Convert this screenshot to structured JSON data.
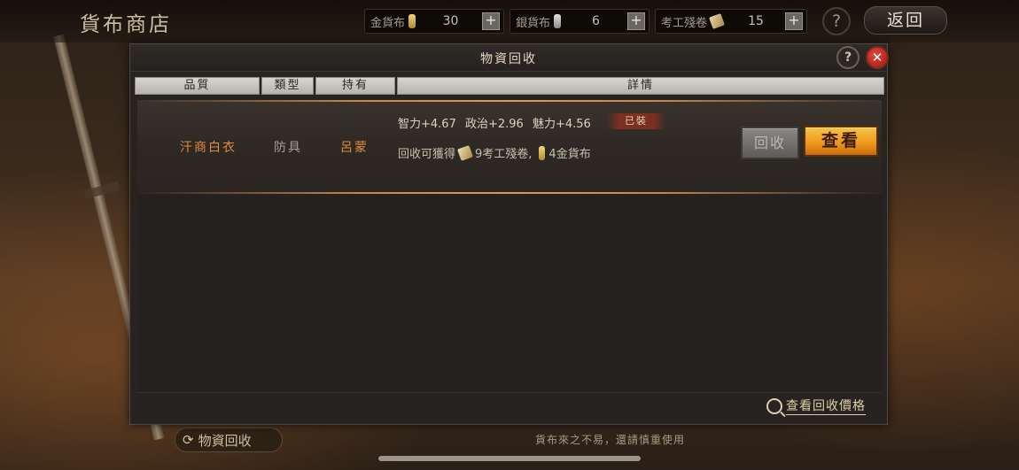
{
  "shop": {
    "title": "貨布商店"
  },
  "currencies": [
    {
      "label": "金貨布",
      "icon": "gold-coin-icon",
      "value": "30",
      "add": "+"
    },
    {
      "label": "銀貨布",
      "icon": "silver-coin-icon",
      "value": "6",
      "add": "+"
    },
    {
      "label": "考工殘卷",
      "icon": "scroll-icon",
      "value": "15",
      "add": "+"
    }
  ],
  "topbar": {
    "help": "?",
    "back": "返回"
  },
  "dialog": {
    "title": "物資回收",
    "help": "?",
    "close": "✕",
    "columns": [
      "品質",
      "類型",
      "持有",
      "詳情"
    ],
    "items": [
      {
        "quality": "汗商白衣",
        "type": "防具",
        "owner": "呂蒙",
        "stats": [
          "智力+4.67",
          "政治+2.96",
          "魅力+4.56"
        ],
        "badge": "已裝",
        "reward_prefix": "回收可獲得",
        "reward_scroll": "9考工殘卷,",
        "reward_gold": "4金貨布",
        "recycle_label": "回收",
        "view_label": "查看"
      }
    ],
    "price_link": "查看回收價格"
  },
  "bottom": {
    "recycle_tab": "物資回收",
    "note": "貨布來之不易，還請慎重使用"
  }
}
